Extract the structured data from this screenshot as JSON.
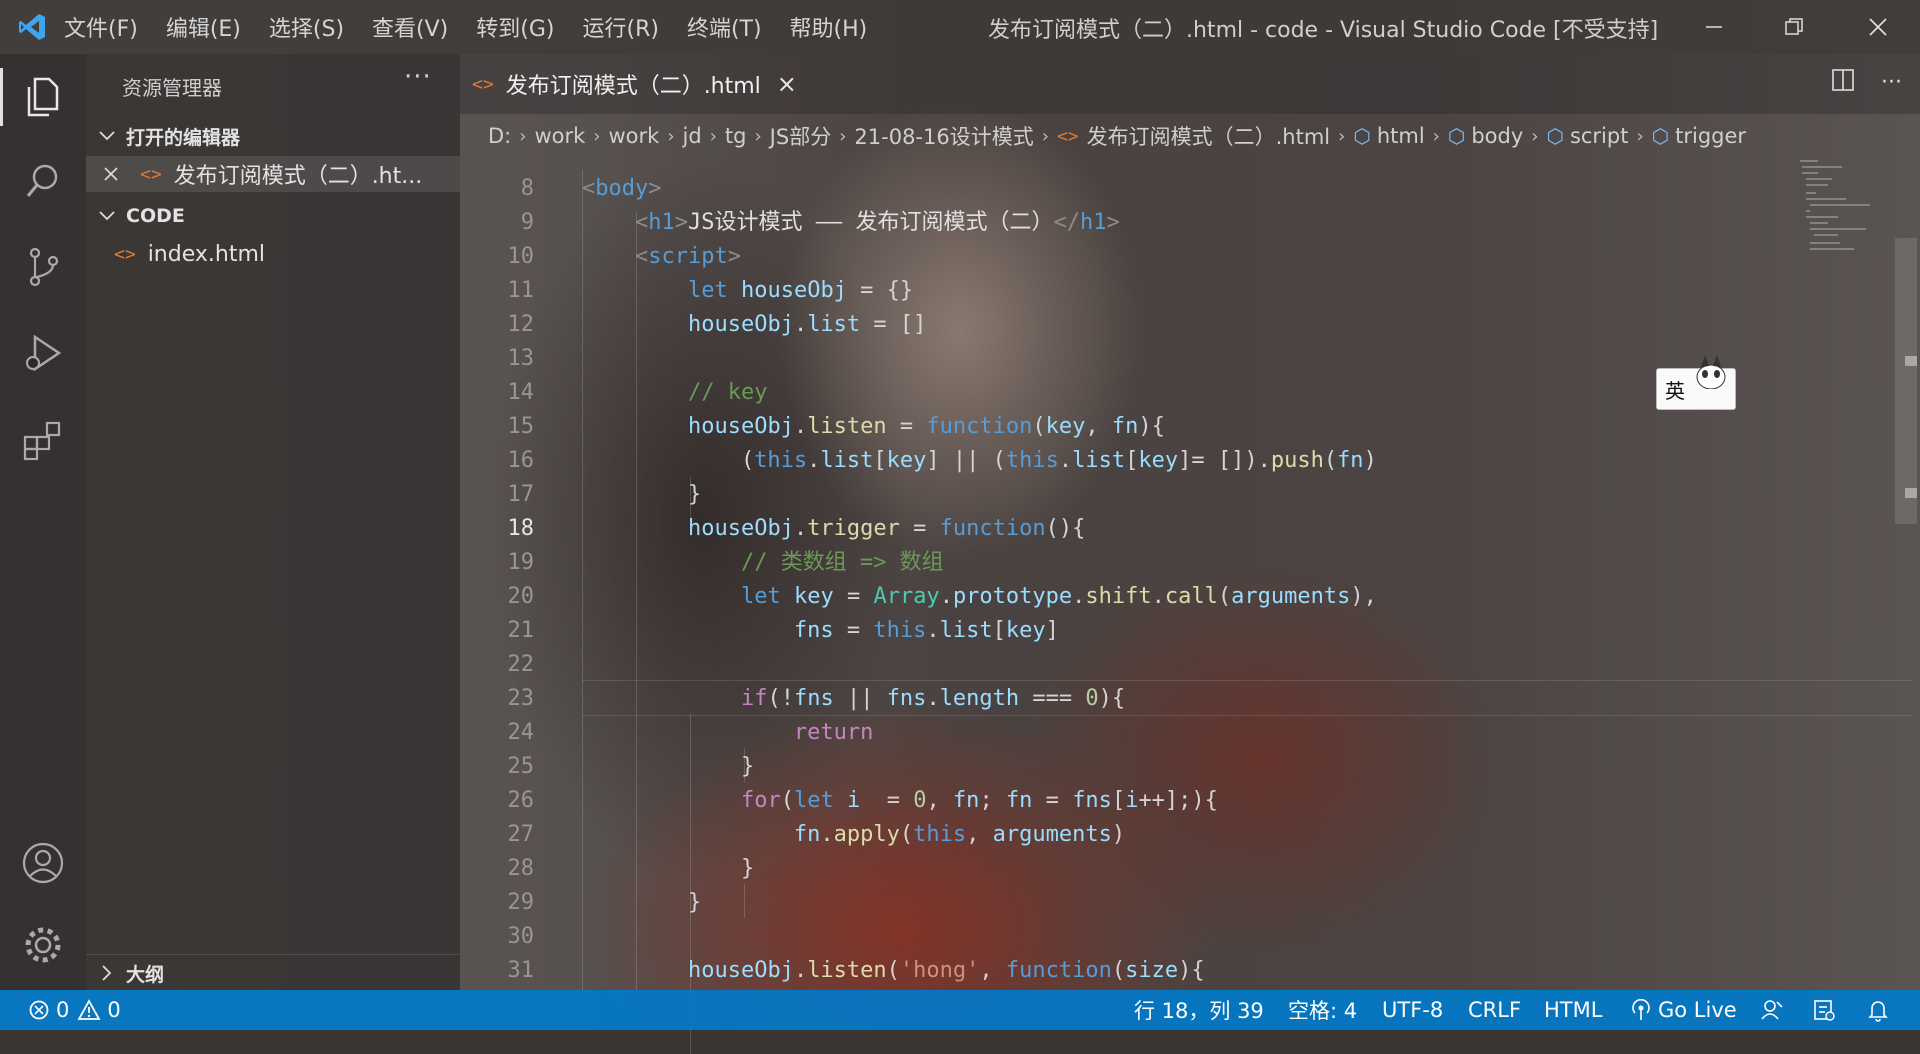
{
  "app": {
    "window_title": "发布订阅模式（二）.html - code - Visual Studio Code [不受支持]"
  },
  "menu": [
    "文件(F)",
    "编辑(E)",
    "选择(S)",
    "查看(V)",
    "转到(G)",
    "运行(R)",
    "终端(T)",
    "帮助(H)"
  ],
  "sidebar": {
    "title": "资源管理器",
    "more": "···",
    "open_editors_label": "打开的编辑器",
    "open_editor_file": "发布订阅模式（二）.ht...",
    "folder_label": "CODE",
    "files": [
      "index.html"
    ],
    "outline_label": "大纲"
  },
  "tab": {
    "label": "发布订阅模式（二）.html",
    "close": "×"
  },
  "breadcrumb": {
    "folders": [
      "D:",
      "work",
      "work",
      "jd",
      "tg",
      "JS部分",
      "21-08-16设计模式"
    ],
    "file": "发布订阅模式（二）.html",
    "symbols": [
      "html",
      "body",
      "script",
      "trigger"
    ]
  },
  "code": {
    "current_line": 18,
    "line_numbers": [
      "8",
      "9",
      "10",
      "11",
      "12",
      "13",
      "14",
      "15",
      "16",
      "17",
      "18",
      "19",
      "20",
      "21",
      "22",
      "23",
      "24",
      "25",
      "26",
      "27",
      "28",
      "29",
      "30",
      "31"
    ],
    "lines": [
      [
        {
          "c": "tg",
          "t": "<"
        },
        {
          "c": "tn",
          "t": "body"
        },
        {
          "c": "tg",
          "t": ">"
        }
      ],
      [
        {
          "c": "pl",
          "t": "    "
        },
        {
          "c": "tg",
          "t": "<"
        },
        {
          "c": "tn",
          "t": "h1"
        },
        {
          "c": "tg",
          "t": ">"
        },
        {
          "c": "tx",
          "t": "JS设计模式 —— 发布订阅模式（二）"
        },
        {
          "c": "tg",
          "t": "</"
        },
        {
          "c": "tn",
          "t": "h1"
        },
        {
          "c": "tg",
          "t": ">"
        }
      ],
      [
        {
          "c": "pl",
          "t": "    "
        },
        {
          "c": "tg",
          "t": "<"
        },
        {
          "c": "tn",
          "t": "script"
        },
        {
          "c": "tg",
          "t": ">"
        }
      ],
      [
        {
          "c": "pl",
          "t": "        "
        },
        {
          "c": "kw",
          "t": "let"
        },
        {
          "c": "pl",
          "t": " "
        },
        {
          "c": "vr",
          "t": "houseObj"
        },
        {
          "c": "pl",
          "t": " = {}"
        }
      ],
      [
        {
          "c": "pl",
          "t": "        "
        },
        {
          "c": "vr",
          "t": "houseObj"
        },
        {
          "c": "pl",
          "t": "."
        },
        {
          "c": "vr",
          "t": "list"
        },
        {
          "c": "pl",
          "t": " = []"
        }
      ],
      [],
      [
        {
          "c": "pl",
          "t": "        "
        },
        {
          "c": "cm",
          "t": "// key"
        }
      ],
      [
        {
          "c": "pl",
          "t": "        "
        },
        {
          "c": "vr",
          "t": "houseObj"
        },
        {
          "c": "pl",
          "t": "."
        },
        {
          "c": "fn",
          "t": "listen"
        },
        {
          "c": "pl",
          "t": " = "
        },
        {
          "c": "kw",
          "t": "function"
        },
        {
          "c": "pl",
          "t": "("
        },
        {
          "c": "vr",
          "t": "key"
        },
        {
          "c": "pl",
          "t": ", "
        },
        {
          "c": "vr",
          "t": "fn"
        },
        {
          "c": "pl",
          "t": "){"
        }
      ],
      [
        {
          "c": "pl",
          "t": "            ("
        },
        {
          "c": "kw",
          "t": "this"
        },
        {
          "c": "pl",
          "t": "."
        },
        {
          "c": "vr",
          "t": "list"
        },
        {
          "c": "pl",
          "t": "["
        },
        {
          "c": "vr",
          "t": "key"
        },
        {
          "c": "pl",
          "t": "] || ("
        },
        {
          "c": "kw",
          "t": "this"
        },
        {
          "c": "pl",
          "t": "."
        },
        {
          "c": "vr",
          "t": "list"
        },
        {
          "c": "pl",
          "t": "["
        },
        {
          "c": "vr",
          "t": "key"
        },
        {
          "c": "pl",
          "t": "]= [])."
        },
        {
          "c": "fn",
          "t": "push"
        },
        {
          "c": "pl",
          "t": "("
        },
        {
          "c": "vr",
          "t": "fn"
        },
        {
          "c": "pl",
          "t": ")"
        }
      ],
      [
        {
          "c": "pl",
          "t": "        }"
        }
      ],
      [
        {
          "c": "pl",
          "t": "        "
        },
        {
          "c": "vr",
          "t": "houseObj"
        },
        {
          "c": "pl",
          "t": "."
        },
        {
          "c": "fn",
          "t": "trigger"
        },
        {
          "c": "pl",
          "t": " = "
        },
        {
          "c": "kw",
          "t": "function"
        },
        {
          "c": "pl",
          "t": "(){"
        }
      ],
      [
        {
          "c": "pl",
          "t": "            "
        },
        {
          "c": "cm",
          "t": "// 类数组 => 数组"
        }
      ],
      [
        {
          "c": "pl",
          "t": "            "
        },
        {
          "c": "kw",
          "t": "let"
        },
        {
          "c": "pl",
          "t": " "
        },
        {
          "c": "vr",
          "t": "key"
        },
        {
          "c": "pl",
          "t": " = "
        },
        {
          "c": "cl",
          "t": "Array"
        },
        {
          "c": "pl",
          "t": "."
        },
        {
          "c": "vr",
          "t": "prototype"
        },
        {
          "c": "pl",
          "t": "."
        },
        {
          "c": "fn",
          "t": "shift"
        },
        {
          "c": "pl",
          "t": "."
        },
        {
          "c": "fn",
          "t": "call"
        },
        {
          "c": "pl",
          "t": "("
        },
        {
          "c": "vr",
          "t": "arguments"
        },
        {
          "c": "pl",
          "t": "),"
        }
      ],
      [
        {
          "c": "pl",
          "t": "                "
        },
        {
          "c": "vr",
          "t": "fns"
        },
        {
          "c": "pl",
          "t": " = "
        },
        {
          "c": "kw",
          "t": "this"
        },
        {
          "c": "pl",
          "t": "."
        },
        {
          "c": "vr",
          "t": "list"
        },
        {
          "c": "pl",
          "t": "["
        },
        {
          "c": "vr",
          "t": "key"
        },
        {
          "c": "pl",
          "t": "]"
        }
      ],
      [],
      [
        {
          "c": "pl",
          "t": "            "
        },
        {
          "c": "ctl",
          "t": "if"
        },
        {
          "c": "pl",
          "t": "(!"
        },
        {
          "c": "vr",
          "t": "fns"
        },
        {
          "c": "pl",
          "t": " || "
        },
        {
          "c": "vr",
          "t": "fns"
        },
        {
          "c": "pl",
          "t": "."
        },
        {
          "c": "vr",
          "t": "length"
        },
        {
          "c": "pl",
          "t": " === "
        },
        {
          "c": "nm",
          "t": "0"
        },
        {
          "c": "pl",
          "t": "){"
        }
      ],
      [
        {
          "c": "pl",
          "t": "                "
        },
        {
          "c": "ctl",
          "t": "return"
        }
      ],
      [
        {
          "c": "pl",
          "t": "            }"
        }
      ],
      [
        {
          "c": "pl",
          "t": "            "
        },
        {
          "c": "ctl",
          "t": "for"
        },
        {
          "c": "pl",
          "t": "("
        },
        {
          "c": "kw",
          "t": "let"
        },
        {
          "c": "pl",
          "t": " "
        },
        {
          "c": "vr",
          "t": "i"
        },
        {
          "c": "pl",
          "t": "  = "
        },
        {
          "c": "nm",
          "t": "0"
        },
        {
          "c": "pl",
          "t": ", "
        },
        {
          "c": "vr",
          "t": "fn"
        },
        {
          "c": "pl",
          "t": "; "
        },
        {
          "c": "vr",
          "t": "fn"
        },
        {
          "c": "pl",
          "t": " = "
        },
        {
          "c": "vr",
          "t": "fns"
        },
        {
          "c": "pl",
          "t": "["
        },
        {
          "c": "vr",
          "t": "i"
        },
        {
          "c": "pl",
          "t": "++];){"
        }
      ],
      [
        {
          "c": "pl",
          "t": "                "
        },
        {
          "c": "vr",
          "t": "fn"
        },
        {
          "c": "pl",
          "t": "."
        },
        {
          "c": "fn",
          "t": "apply"
        },
        {
          "c": "pl",
          "t": "("
        },
        {
          "c": "kw",
          "t": "this"
        },
        {
          "c": "pl",
          "t": ", "
        },
        {
          "c": "vr",
          "t": "arguments"
        },
        {
          "c": "pl",
          "t": ")"
        }
      ],
      [
        {
          "c": "pl",
          "t": "            }"
        }
      ],
      [
        {
          "c": "pl",
          "t": "        }"
        }
      ],
      [],
      [
        {
          "c": "pl",
          "t": "        "
        },
        {
          "c": "vr",
          "t": "houseObj"
        },
        {
          "c": "pl",
          "t": "."
        },
        {
          "c": "fn",
          "t": "listen"
        },
        {
          "c": "pl",
          "t": "("
        },
        {
          "c": "st",
          "t": "'hong'"
        },
        {
          "c": "pl",
          "t": ", "
        },
        {
          "c": "kw",
          "t": "function"
        },
        {
          "c": "pl",
          "t": "("
        },
        {
          "c": "vr",
          "t": "size"
        },
        {
          "c": "pl",
          "t": "){"
        }
      ]
    ]
  },
  "ime": {
    "label": "英"
  },
  "statusbar": {
    "errors": "0",
    "warnings": "0",
    "position": "行 18，列 39",
    "indent": "空格: 4",
    "encoding": "UTF-8",
    "eol": "CRLF",
    "language": "HTML",
    "golive": "Go Live"
  },
  "colors": {
    "statusbar": "#007acc",
    "accent": "#75beff"
  }
}
